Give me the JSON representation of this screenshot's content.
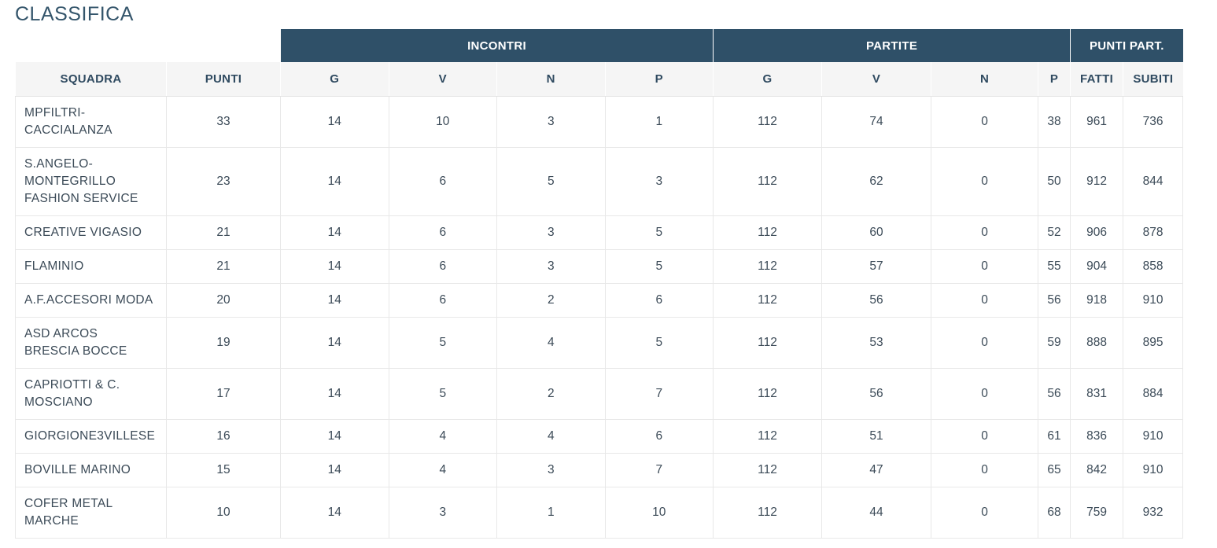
{
  "page_title": "CLASSIFICA",
  "groups": {
    "incontri": "INCONTRI",
    "partite": "PARTITE",
    "punti_part": "PUNTI PART."
  },
  "columns": [
    "SQUADRA",
    "PUNTI",
    "G",
    "V",
    "N",
    "P",
    "G",
    "V",
    "N",
    "P",
    "FATTI",
    "SUBITI"
  ],
  "rows": [
    {
      "team": "MPFILTRI-\nCACCIALANZA",
      "punti": "33",
      "ig": "14",
      "iv": "10",
      "in": "3",
      "ip": "1",
      "pg": "112",
      "pv": "74",
      "pn": "0",
      "pp": "38",
      "fatti": "961",
      "subiti": "736"
    },
    {
      "team": "S.ANGELO-\nMONTEGRILLO\nFASHION SERVICE",
      "punti": "23",
      "ig": "14",
      "iv": "6",
      "in": "5",
      "ip": "3",
      "pg": "112",
      "pv": "62",
      "pn": "0",
      "pp": "50",
      "fatti": "912",
      "subiti": "844"
    },
    {
      "team": "CREATIVE VIGASIO",
      "punti": "21",
      "ig": "14",
      "iv": "6",
      "in": "3",
      "ip": "5",
      "pg": "112",
      "pv": "60",
      "pn": "0",
      "pp": "52",
      "fatti": "906",
      "subiti": "878"
    },
    {
      "team": "FLAMINIO",
      "punti": "21",
      "ig": "14",
      "iv": "6",
      "in": "3",
      "ip": "5",
      "pg": "112",
      "pv": "57",
      "pn": "0",
      "pp": "55",
      "fatti": "904",
      "subiti": "858"
    },
    {
      "team": "A.F.ACCESORI MODA",
      "punti": "20",
      "ig": "14",
      "iv": "6",
      "in": "2",
      "ip": "6",
      "pg": "112",
      "pv": "56",
      "pn": "0",
      "pp": "56",
      "fatti": "918",
      "subiti": "910"
    },
    {
      "team": "ASD ARCOS\nBRESCIA BOCCE",
      "punti": "19",
      "ig": "14",
      "iv": "5",
      "in": "4",
      "ip": "5",
      "pg": "112",
      "pv": "53",
      "pn": "0",
      "pp": "59",
      "fatti": "888",
      "subiti": "895"
    },
    {
      "team": "CAPRIOTTI & C.\nMOSCIANO",
      "punti": "17",
      "ig": "14",
      "iv": "5",
      "in": "2",
      "ip": "7",
      "pg": "112",
      "pv": "56",
      "pn": "0",
      "pp": "56",
      "fatti": "831",
      "subiti": "884"
    },
    {
      "team": "GIORGIONE3VILLESE",
      "punti": "16",
      "ig": "14",
      "iv": "4",
      "in": "4",
      "ip": "6",
      "pg": "112",
      "pv": "51",
      "pn": "0",
      "pp": "61",
      "fatti": "836",
      "subiti": "910"
    },
    {
      "team": "BOVILLE MARINO",
      "punti": "15",
      "ig": "14",
      "iv": "4",
      "in": "3",
      "ip": "7",
      "pg": "112",
      "pv": "47",
      "pn": "0",
      "pp": "65",
      "fatti": "842",
      "subiti": "910"
    },
    {
      "team": "COFER METAL\nMARCHE",
      "punti": "10",
      "ig": "14",
      "iv": "3",
      "in": "1",
      "ip": "10",
      "pg": "112",
      "pv": "44",
      "pn": "0",
      "pp": "68",
      "fatti": "759",
      "subiti": "932"
    }
  ]
}
